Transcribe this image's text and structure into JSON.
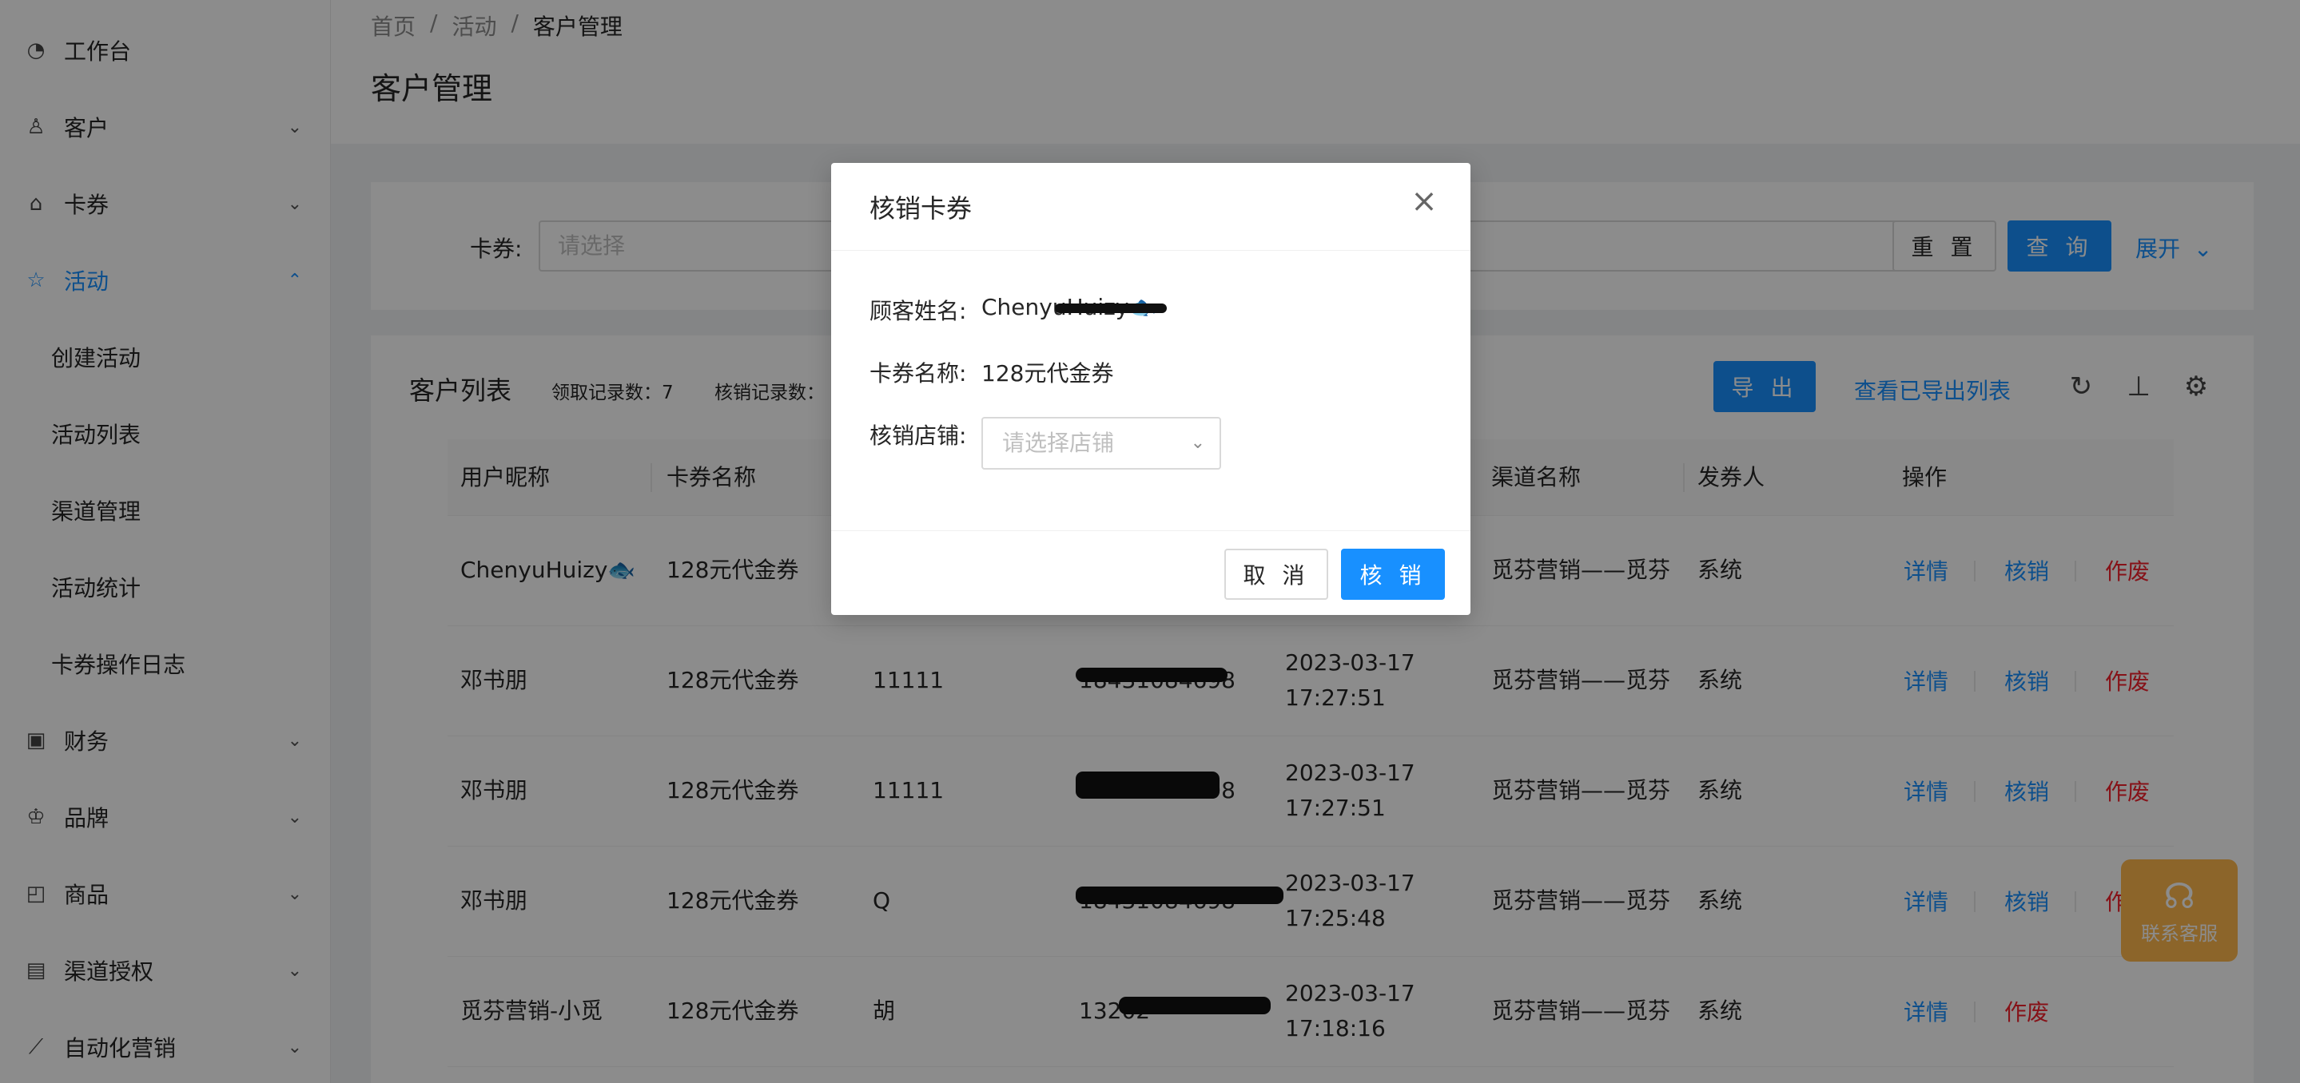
{
  "sidebar": {
    "items": [
      {
        "label": "工作台",
        "icon": "dashboard-icon",
        "arrow": ""
      },
      {
        "label": "客户",
        "icon": "user-icon",
        "arrow": "⌄"
      },
      {
        "label": "卡券",
        "icon": "gift-icon",
        "arrow": "⌄"
      },
      {
        "label": "活动",
        "icon": "star-icon",
        "arrow": "⌃"
      },
      {
        "label": "财务",
        "icon": "finance-icon",
        "arrow": "⌄"
      },
      {
        "label": "品牌",
        "icon": "brand-icon",
        "arrow": "⌄"
      },
      {
        "label": "商品",
        "icon": "bag-icon",
        "arrow": "⌄"
      },
      {
        "label": "渠道授权",
        "icon": "auth-icon",
        "arrow": "⌄"
      },
      {
        "label": "自动化营销",
        "icon": "chart-line-icon",
        "arrow": "⌄"
      }
    ],
    "sub_items": [
      "创建活动",
      "活动列表",
      "渠道管理",
      "活动统计",
      "卡券操作日志"
    ]
  },
  "header": {
    "breadcrumb": [
      "首页",
      "/",
      "活动",
      "/",
      "客户管理"
    ],
    "title": "客户管理"
  },
  "search": {
    "label": "卡券:",
    "placeholder": "请选择",
    "reset": "重 置",
    "query": "查 询",
    "expand": "展开"
  },
  "table": {
    "title": "客户列表",
    "stat_received": "领取记录数：7",
    "stat_verified": "核销记录数：",
    "export": "导 出",
    "view_exports": "查看已导出列表",
    "columns": [
      "用户昵称",
      "卡券名称",
      "渠道名称",
      "发券人",
      "操作"
    ],
    "rows": [
      {
        "nick": "ChenyuHuizy🐟",
        "card": "128元代金券",
        "col3": "",
        "col4": "",
        "time1": "",
        "time2": "",
        "channel": "觅芬营销——觅芬",
        "issuer": "系统",
        "ops": [
          "详情",
          "核销",
          "作废"
        ]
      },
      {
        "nick": "邓书朋",
        "card": "128元代金券",
        "col3": "11111",
        "col4": "18431084698",
        "time1": "2023-03-17",
        "time2": "17:27:51",
        "channel": "觅芬营销——觅芬",
        "issuer": "系统",
        "ops": [
          "详情",
          "核销",
          "作废"
        ]
      },
      {
        "nick": "邓书朋",
        "card": "128元代金券",
        "col3": "11111",
        "col4": "18431084698",
        "time1": "2023-03-17",
        "time2": "17:27:51",
        "channel": "觅芬营销——觅芬",
        "issuer": "系统",
        "ops": [
          "详情",
          "核销",
          "作废"
        ]
      },
      {
        "nick": "邓书朋",
        "card": "128元代金券",
        "col3": "Q",
        "col4": "18431084698",
        "time1": "2023-03-17",
        "time2": "17:25:48",
        "channel": "觅芬营销——觅芬",
        "issuer": "系统",
        "ops": [
          "详情",
          "核销",
          "作废"
        ]
      },
      {
        "nick": "觅芬营销-小觅",
        "card": "128元代金券",
        "col3": "胡",
        "col4": "13202",
        "time1": "2023-03-17",
        "time2": "17:18:16",
        "channel": "觅芬营销——觅芬",
        "issuer": "系统",
        "ops": [
          "详情",
          "作废"
        ]
      }
    ]
  },
  "modal": {
    "title": "核销卡券",
    "customer_label": "顾客姓名:",
    "customer_value": "ChenyuHuizy🐟",
    "card_label": "卡券名称:",
    "card_value": "128元代金券",
    "store_label": "核销店铺:",
    "store_placeholder": "请选择店铺",
    "cancel": "取 消",
    "confirm": "核 销"
  },
  "service": {
    "label": "联系客服"
  },
  "colors": {
    "primary": "#1890ff",
    "danger": "#f5222d",
    "service": "#ffb84d"
  }
}
